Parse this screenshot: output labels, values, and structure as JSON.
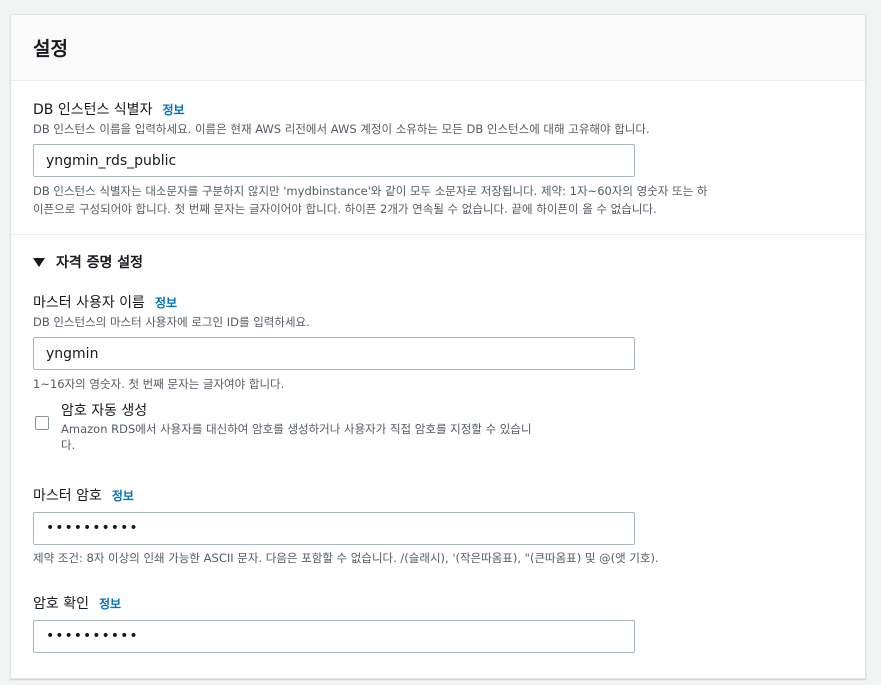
{
  "panel": {
    "title": "설정"
  },
  "identifier": {
    "label": "DB 인스턴스 식별자",
    "info": "정보",
    "description": "DB 인스턴스 이름을 입력하세요. 이름은 현재 AWS 리전에서 AWS 계정이 소유하는 모든 DB 인스턴스에 대해 고유해야 합니다.",
    "value": "yngmin_rds_public",
    "constraint_line1": "DB 인스턴스 식별자는 대소문자를 구분하지 않지만 'mydbinstance'와 같이 모두 소문자로 저장됩니다. 제약: 1자~60자의 영숫자 또는 하",
    "constraint_line2": "이픈으로 구성되어야 합니다. 첫 번째 문자는 글자이어야 합니다. 하이픈 2개가 연속될 수 없습니다. 끝에 하이픈이 올 수 없습니다."
  },
  "credentials": {
    "section_title": "자격 증명 설정",
    "master_username": {
      "label": "마스터 사용자 이름",
      "info": "정보",
      "description": "DB 인스턴스의 마스터 사용자에 로그인 ID를 입력하세요.",
      "value": "yngmin",
      "constraint": "1~16자의 영숫자. 첫 번째 문자는 글자여야 합니다."
    },
    "auto_generate": {
      "label": "암호 자동 생성",
      "description_line1": "Amazon RDS에서 사용자를 대신하여 암호를 생성하거나 사용자가 직접 암호를 지정할 수 있습니",
      "description_line2": "다."
    },
    "master_password": {
      "label": "마스터 암호",
      "info": "정보",
      "value": "••••••••••",
      "constraint": "제약 조건: 8자 이상의 인쇄 가능한 ASCII 문자. 다음은 포함할 수 없습니다. /(슬래시), '(작은따옴표), \"(큰따옴표) 및 @(앳 기호)."
    },
    "confirm_password": {
      "label": "암호 확인",
      "info": "정보",
      "value": "••••••••••"
    }
  }
}
